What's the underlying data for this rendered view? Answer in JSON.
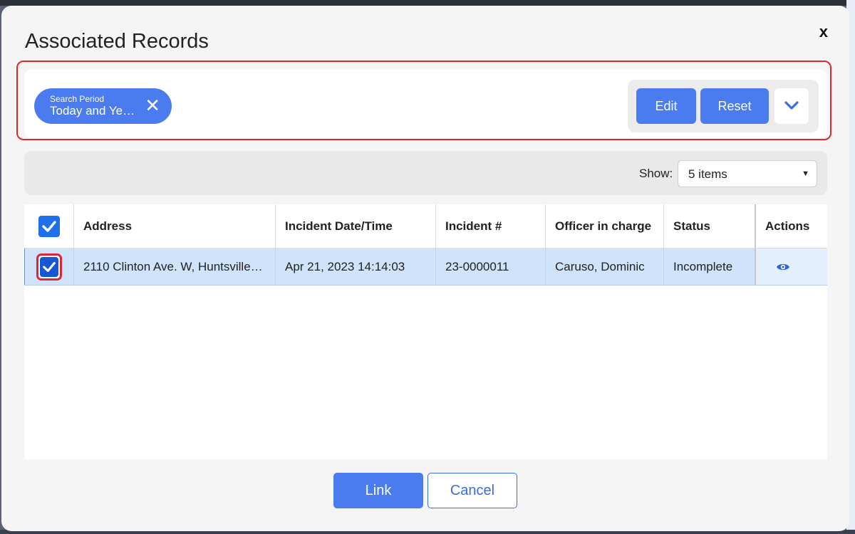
{
  "dialog": {
    "title": "Associated Records",
    "close_label": "x"
  },
  "filters": {
    "chip_label": "Search Period",
    "chip_value": "Today and Yest...",
    "chip_remove_icon": "close-icon",
    "edit_label": "Edit",
    "reset_label": "Reset",
    "expand_icon": "chevron-down-icon"
  },
  "show": {
    "label": "Show:",
    "selected": "5 items"
  },
  "table": {
    "columns": [
      "Address",
      "Incident Date/Time",
      "Incident #",
      "Officer in charge",
      "Status",
      "Actions"
    ],
    "rows": [
      {
        "address": "2110 Clinton Ave. W, Huntsville, AL",
        "incident_datetime": "Apr 21, 2023 14:14:03",
        "incident_number": "23-0000011",
        "officer": "Caruso, Dominic",
        "status": "Incomplete",
        "selected": true,
        "action_icon": "eye-icon"
      }
    ]
  },
  "footer": {
    "link_label": "Link",
    "cancel_label": "Cancel"
  },
  "colors": {
    "accent": "#4a7cf0",
    "highlight": "#e0262f",
    "row_selected": "#cfe3fb"
  }
}
